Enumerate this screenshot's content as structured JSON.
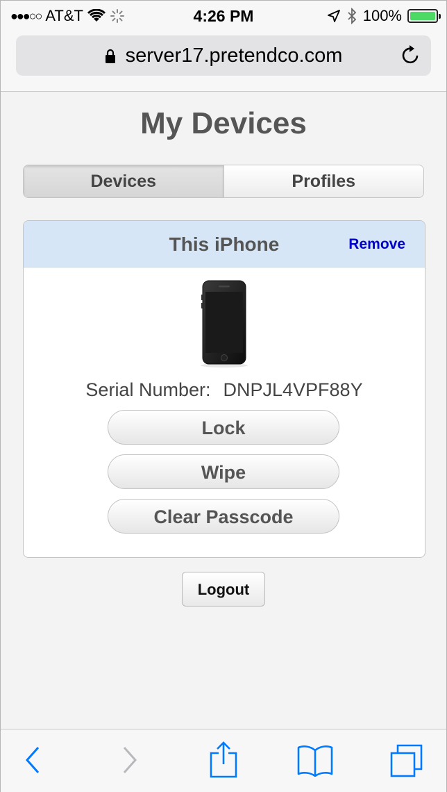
{
  "status_bar": {
    "carrier": "AT&T",
    "signal_dots": "●●●○○",
    "time": "4:26 PM",
    "battery_percent": "100%",
    "battery_level": 1.0
  },
  "browser": {
    "url": "server17.pretendco.com"
  },
  "page": {
    "title": "My Devices",
    "tabs": [
      {
        "label": "Devices",
        "active": true
      },
      {
        "label": "Profiles",
        "active": false
      }
    ],
    "device_card": {
      "title": "This iPhone",
      "remove_label": "Remove",
      "serial_label": "Serial Number:",
      "serial_value": "DNPJL4VPF88Y",
      "actions": [
        "Lock",
        "Wipe",
        "Clear Passcode"
      ]
    },
    "logout_label": "Logout"
  },
  "colors": {
    "accent_blue": "#007aff",
    "link_blue": "#0000cc",
    "card_header_bg": "#d6e6f6",
    "battery_green": "#4cd964"
  },
  "icons": [
    "wifi-icon",
    "activity-spinner-icon",
    "location-arrow-icon",
    "bluetooth-icon",
    "battery-icon",
    "lock-icon",
    "reload-icon",
    "back-icon",
    "forward-icon",
    "share-icon",
    "bookmarks-icon",
    "tabs-icon"
  ]
}
